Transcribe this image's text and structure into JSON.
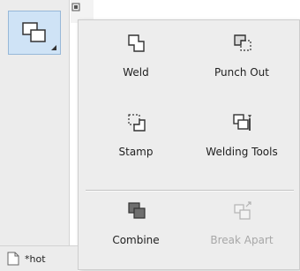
{
  "toolbar": {
    "active_tool_icon": "shaping-icon"
  },
  "flyout": {
    "items": [
      {
        "label": "Weld",
        "icon": "weld-icon",
        "enabled": true
      },
      {
        "label": "Punch Out",
        "icon": "punch-out-icon",
        "enabled": true
      },
      {
        "label": "Stamp",
        "icon": "stamp-icon",
        "enabled": true
      },
      {
        "label": "Welding Tools",
        "icon": "welding-tools-icon",
        "enabled": true
      },
      {
        "label": "Combine",
        "icon": "combine-icon",
        "enabled": true
      },
      {
        "label": "Break Apart",
        "icon": "break-apart-icon",
        "enabled": false
      }
    ]
  },
  "document": {
    "name": "*hot"
  },
  "colors": {
    "active_button_bg": "#cfe3f6",
    "disabled_text": "#a7a7a7"
  }
}
